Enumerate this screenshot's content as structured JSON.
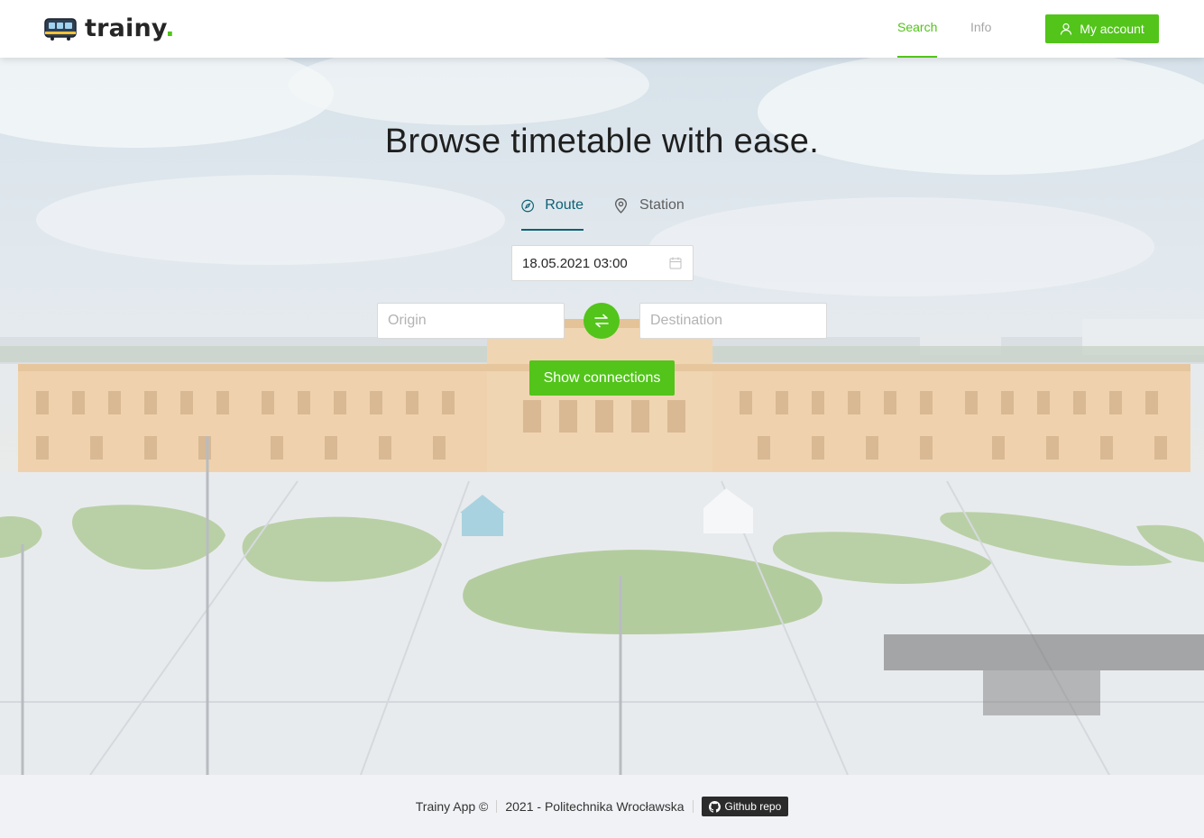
{
  "brand": {
    "name": "trainy",
    "dot": "."
  },
  "nav": {
    "search": "Search",
    "info": "Info",
    "account": "My account"
  },
  "hero": {
    "title": "Browse timetable with ease.",
    "tabs": {
      "route": "Route",
      "station": "Station"
    },
    "date_value": "18.05.2021 03:00",
    "origin_placeholder": "Origin",
    "destination_placeholder": "Destination",
    "submit": "Show connections"
  },
  "footer": {
    "app": "Trainy App ©",
    "credit": "2021 - Politechnika Wrocławska",
    "repo": "Github repo"
  },
  "colors": {
    "accent": "#52c41a",
    "tab_active": "#0e6174"
  },
  "icons": [
    "train-logo-icon",
    "user-icon",
    "compass-icon",
    "location-pin-icon",
    "calendar-icon",
    "swap-icon",
    "github-icon"
  ]
}
